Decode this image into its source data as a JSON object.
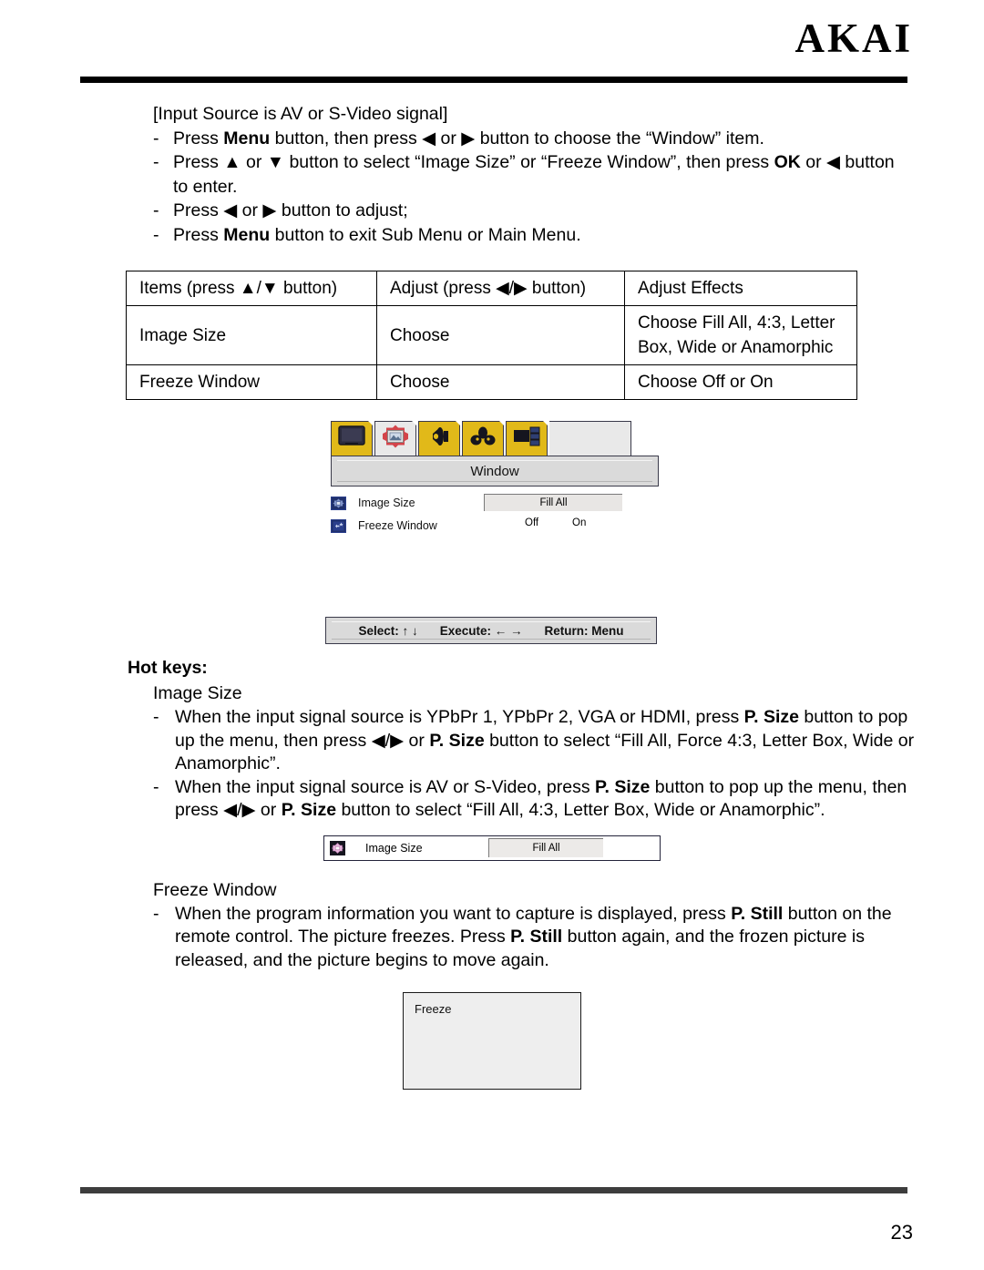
{
  "header": {
    "brand": "AKAI"
  },
  "intro": {
    "heading": "[Input Source is AV or S-Video signal]",
    "bullets": [
      {
        "dash": "-",
        "parts": [
          {
            "t": "Press ",
            "b": false
          },
          {
            "t": "Menu",
            "b": true
          },
          {
            "t": " button, then press ◀ or ▶ button to choose the “Window” item.",
            "b": false
          }
        ]
      },
      {
        "dash": "-",
        "parts": [
          {
            "t": "Press ▲ or ▼ button to select “Image Size” or “Freeze Window”, then press ",
            "b": false
          },
          {
            "t": "OK",
            "b": true
          },
          {
            "t": " or ◀ button to enter.",
            "b": false
          }
        ]
      },
      {
        "dash": "-",
        "parts": [
          {
            "t": "Press ◀ or ▶ button to adjust;",
            "b": false
          }
        ]
      },
      {
        "dash": "-",
        "parts": [
          {
            "t": "Press ",
            "b": false
          },
          {
            "t": "Menu",
            "b": true
          },
          {
            "t": " button to exit Sub Menu or Main Menu.",
            "b": false
          }
        ]
      }
    ]
  },
  "table": {
    "headers": [
      "Items (press ▲/▼ button)",
      "Adjust (press ◀/▶ button)",
      "Adjust Effects"
    ],
    "rows": [
      {
        "item": "Image Size",
        "adjust": "Choose",
        "effect_line1": "Choose Fill All, 4:3, Letter",
        "effect_line2": "Box, Wide or Anamorphic"
      },
      {
        "item": "Freeze Window",
        "adjust": "Choose",
        "effect_line1": "Choose Off or On",
        "effect_line2": ""
      }
    ]
  },
  "osd": {
    "tabs": [
      {
        "icon": "tv-screen-icon",
        "selected": false
      },
      {
        "icon": "picture-frame-icon",
        "selected": true
      },
      {
        "icon": "speaker-icon",
        "selected": false
      },
      {
        "icon": "clover-icon",
        "selected": false
      },
      {
        "icon": "window-layout-icon",
        "selected": false
      }
    ],
    "title": "Window",
    "rows": [
      {
        "icon": "image-size-icon",
        "label": "Image Size",
        "type": "value",
        "value": "Fill All"
      },
      {
        "icon": "freeze-window-icon",
        "label": "Freeze Window",
        "type": "toggle",
        "off_label": "Off",
        "on_label": "On"
      }
    ],
    "statusbar": {
      "select": "Select: ↑ ↓",
      "execute": "Execute: ← →",
      "return": "Return:  Menu"
    },
    "colors": {
      "tab_yellow": "#e1b919",
      "tab_selected": "#e9e9e9",
      "panel_gray": "#dadada",
      "icon_blue": "#20306c"
    }
  },
  "hotkeys": {
    "title": "Hot keys:",
    "section1": {
      "subtitle": "Image Size",
      "items": [
        {
          "dash": "-",
          "parts": [
            {
              "t": "When the input signal source is YPbPr 1, YPbPr 2, VGA or HDMI, press ",
              "b": false
            },
            {
              "t": "P. Size",
              "b": true
            },
            {
              "t": " button to pop up the menu, then press ◀/▶ or ",
              "b": false
            },
            {
              "t": "P. Size",
              "b": true
            },
            {
              "t": " button to select “Fill All, Force 4:3, Letter Box, Wide or Anamorphic”.",
              "b": false
            }
          ]
        },
        {
          "dash": "-",
          "parts": [
            {
              "t": "When the input signal source is AV or S-Video, press ",
              "b": false
            },
            {
              "t": "P. Size",
              "b": true
            },
            {
              "t": " button to pop up the menu, then press ◀/▶ or ",
              "b": false
            },
            {
              "t": "P. Size",
              "b": true
            },
            {
              "t": " button to select “Fill All, 4:3, Letter Box, Wide or Anamorphic”.",
              "b": false
            }
          ]
        }
      ]
    },
    "popup": {
      "icon": "image-size-icon",
      "label": "Image Size",
      "value": "Fill All"
    },
    "section2": {
      "subtitle": "Freeze Window",
      "items": [
        {
          "dash": "-",
          "parts": [
            {
              "t": "When the program information you want to capture is displayed, press ",
              "b": false
            },
            {
              "t": "P. Still",
              "b": true
            },
            {
              "t": " button on the remote control. The picture freezes. Press ",
              "b": false
            },
            {
              "t": "P. Still",
              "b": true
            },
            {
              "t": " button again, and the frozen picture is released, and the picture begins to move again.",
              "b": false
            }
          ]
        }
      ]
    },
    "freeze_box": {
      "label": "Freeze"
    }
  },
  "footer": {
    "page_number": "23"
  }
}
